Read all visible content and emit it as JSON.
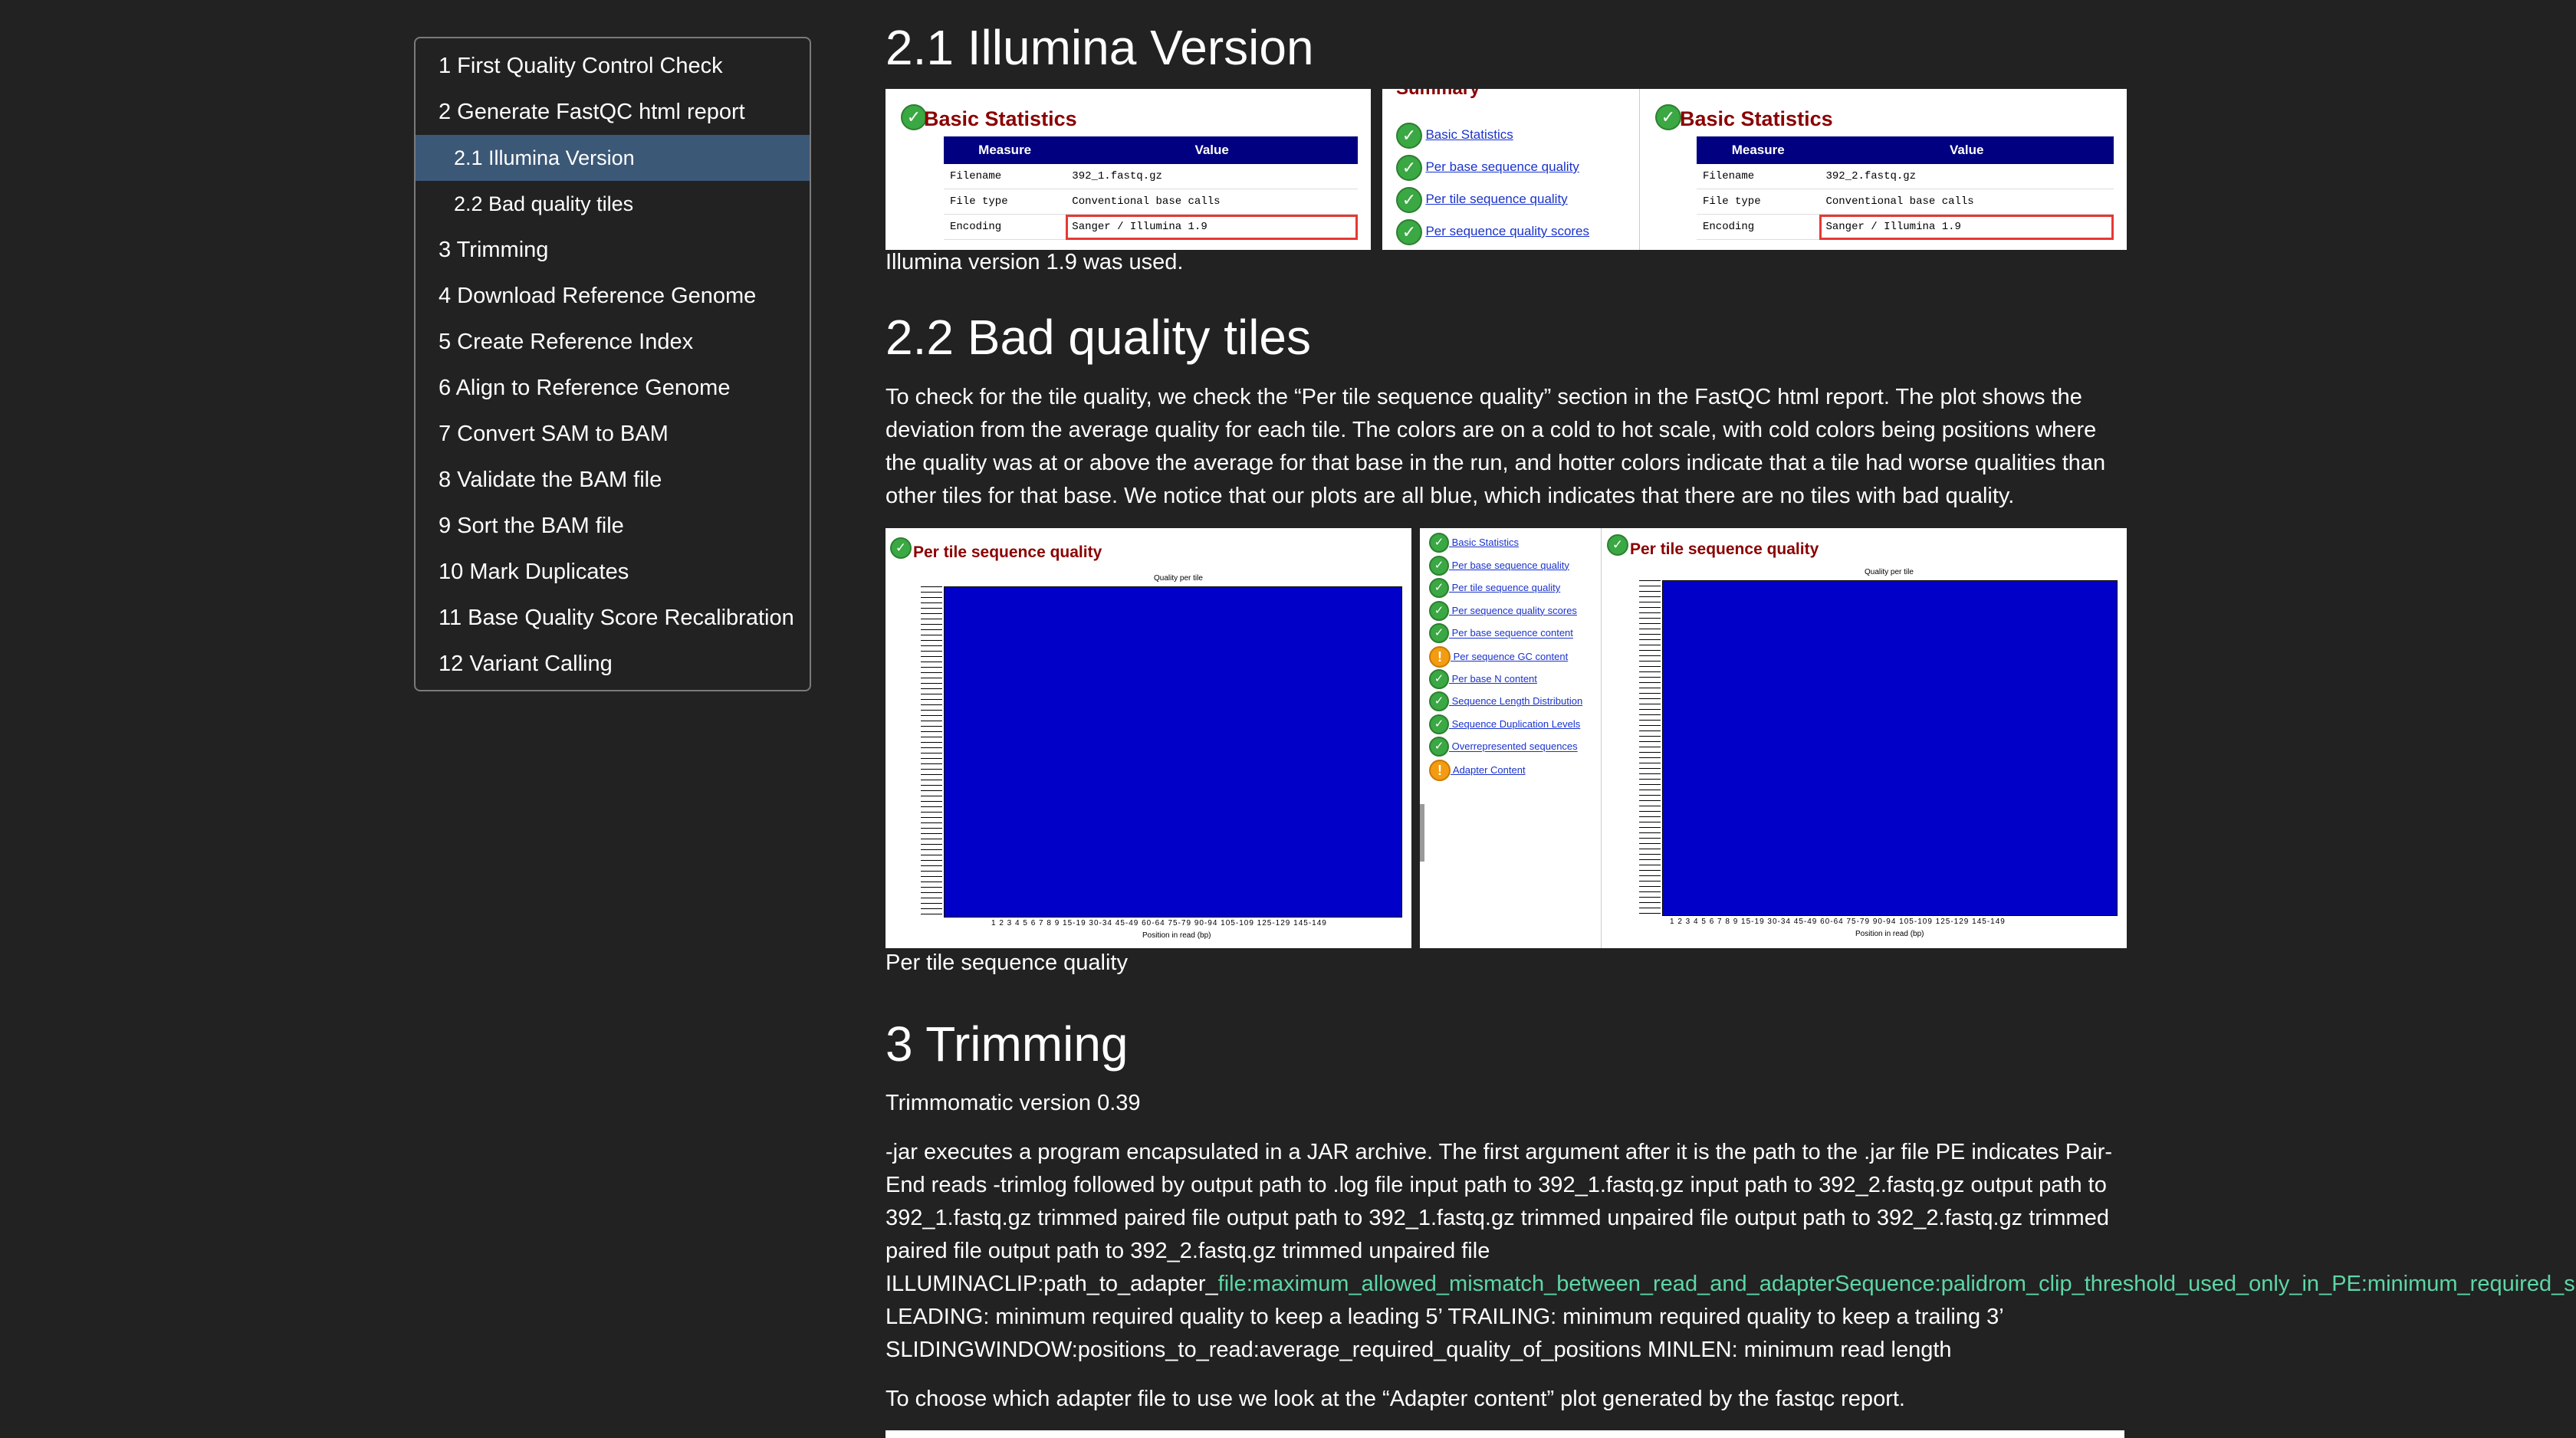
{
  "toc": {
    "items": [
      {
        "label": "1 First Quality Control Check"
      },
      {
        "label": "2 Generate FastQC html report"
      },
      {
        "label": "2.1 Illumina Version"
      },
      {
        "label": "2.2 Bad quality tiles"
      },
      {
        "label": "3 Trimming"
      },
      {
        "label": "4 Download Reference Genome"
      },
      {
        "label": "5 Create Reference Index"
      },
      {
        "label": "6 Align to Reference Genome"
      },
      {
        "label": "7 Convert SAM to BAM"
      },
      {
        "label": "8 Validate the BAM file"
      },
      {
        "label": "9 Sort the BAM file"
      },
      {
        "label": "10 Mark Duplicates"
      },
      {
        "label": "11 Base Quality Score Recalibration"
      },
      {
        "label": "12 Variant Calling"
      }
    ]
  },
  "s21": {
    "heading": "2.1 Illumina Version",
    "caption": "Illumina version 1.9 was used.",
    "img": {
      "bs_title": "Basic Statistics",
      "col_measure": "Measure",
      "col_value": "Value",
      "left_rows": [
        {
          "m": "Filename",
          "v": "392_1.fastq.gz"
        },
        {
          "m": "File type",
          "v": "Conventional base calls"
        },
        {
          "m": "Encoding",
          "v": "Sanger / Illumina 1.9"
        }
      ],
      "right_rows": [
        {
          "m": "Filename",
          "v": "392_2.fastq.gz"
        },
        {
          "m": "File type",
          "v": "Conventional base calls"
        },
        {
          "m": "Encoding",
          "v": "Sanger / Illumina 1.9"
        }
      ],
      "summary_title": "Summary",
      "summary_links": [
        "Basic Statistics",
        "Per base sequence quality",
        "Per tile sequence quality",
        "Per sequence quality scores"
      ]
    }
  },
  "s22": {
    "heading": "2.2 Bad quality tiles",
    "para": "To check for the tile quality, we check the “Per tile sequence quality” section in the FastQC html report. The plot shows the deviation from the average quality for each tile. The colors are on a cold to hot scale, with cold colors being positions where the quality was at or above the average for that base in the run, and hotter colors indicate that a tile had worse qualities than other tiles for that base. We notice that our plots are all blue, which indicates that there are no tiles with bad quality.",
    "caption": "Per tile sequence quality",
    "img": {
      "plot_title": "Per tile sequence quality",
      "plot_subtitle": "Quality per tile",
      "xlabel": "Position in read (bp)",
      "xticks": "1 2 3 4 5 6 7 8 9 15-19 30-34 45-49 60-64 75-79 90-94 105-109 125-129 145-149",
      "summary_links": [
        {
          "label": "Basic Statistics",
          "status": "ok"
        },
        {
          "label": "Per base sequence quality",
          "status": "ok"
        },
        {
          "label": "Per tile sequence quality",
          "status": "ok"
        },
        {
          "label": "Per sequence quality scores",
          "status": "ok"
        },
        {
          "label": "Per base sequence content",
          "status": "ok"
        },
        {
          "label": "Per sequence GC content",
          "status": "warn"
        },
        {
          "label": "Per base N content",
          "status": "ok"
        },
        {
          "label": "Sequence Length Distribution",
          "status": "ok"
        },
        {
          "label": "Sequence Duplication Levels",
          "status": "ok"
        },
        {
          "label": "Overrepresented sequences",
          "status": "ok"
        },
        {
          "label": "Adapter Content",
          "status": "warn"
        }
      ]
    }
  },
  "s3": {
    "heading": "3 Trimming",
    "version": "Trimmomatic version 0.39",
    "para_a": "-jar executes a program encapsulated in a JAR archive. The first argument after it is the path to the .jar file PE indicates Pair-End reads -trimlog followed by output path to .log file input path to 392_1.fastq.gz input path to 392_2.fastq.gz output path to 392_1.fastq.gz trimmed paired file output path to 392_1.fastq.gz trimmed unpaired file output path to 392_2.fastq.gz trimmed paired file output path to 392_2.fastq.gz trimmed unpaired file",
    "para_b_pre": "ILLUMINACLIP:path_to_adapter_",
    "para_b_green": "file:maximum_allowed_mismatch_between_read_and_adapterSequence:palidrom_clip_threshold_used_only_in_PE:minimum_required_sc",
    "para_c": "LEADING: minimum required quality to keep a leading 5’ TRAILING: minimum required quality to keep a trailing 3’",
    "para_d": "SLIDINGWINDOW:positions_to_read:average_required_quality_of_positions MINLEN: minimum read length",
    "para_e": "To choose which adapter file to use we look at the “Adapter content” plot generated by the fastqc report."
  },
  "colors": {
    "background": "#222222",
    "toc_active": "#3c5877",
    "link_green": "#5dd6a6",
    "plot_blue": "#0000c8"
  }
}
